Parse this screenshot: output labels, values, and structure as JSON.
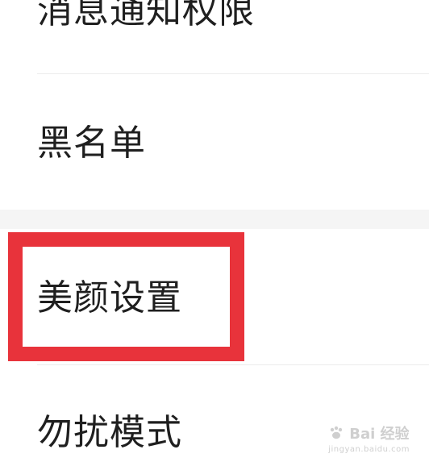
{
  "settings": {
    "items": [
      {
        "label": "消息通知权限"
      },
      {
        "label": "黑名单"
      },
      {
        "label": "美颜设置"
      },
      {
        "label": "勿扰模式"
      }
    ]
  },
  "annotation": {
    "highlight_color": "#e8333b",
    "highlighted_item": "美颜设置"
  },
  "watermark": {
    "brand": "Bai 经验",
    "url": "jingyan.baidu.com"
  }
}
